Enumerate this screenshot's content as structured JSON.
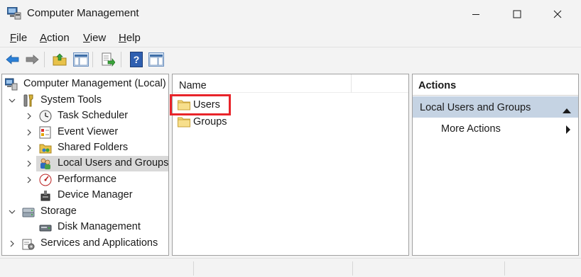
{
  "window": {
    "title": "Computer Management",
    "icon": "computer-management-icon"
  },
  "menu": [
    {
      "label": "File",
      "accel": "F",
      "rest": "ile"
    },
    {
      "label": "Action",
      "accel": "A",
      "rest": "ction"
    },
    {
      "label": "View",
      "accel": "V",
      "rest": "iew"
    },
    {
      "label": "Help",
      "accel": "H",
      "rest": "elp"
    }
  ],
  "toolbar": [
    "back-arrow-icon",
    "forward-arrow-icon",
    "up-folder-icon",
    "show-hide-console-tree-icon",
    "export-list-icon",
    "help-icon",
    "show-hide-action-pane-icon"
  ],
  "tree": {
    "root": "Computer Management (Local)",
    "system_tools": "System Tools",
    "task_scheduler": "Task Scheduler",
    "event_viewer": "Event Viewer",
    "shared_folders": "Shared Folders",
    "local_users": "Local Users and Groups",
    "performance": "Performance",
    "device_manager": "Device Manager",
    "storage": "Storage",
    "disk_management": "Disk Management",
    "services": "Services and Applications"
  },
  "list": {
    "column_name": "Name",
    "items": [
      "Users",
      "Groups"
    ]
  },
  "actions": {
    "header": "Actions",
    "section": "Local Users and Groups",
    "more": "More Actions"
  },
  "colors": {
    "selection": "#d9d9d9",
    "action_section": "#c5d3e3",
    "highlight": "#e8242a"
  }
}
